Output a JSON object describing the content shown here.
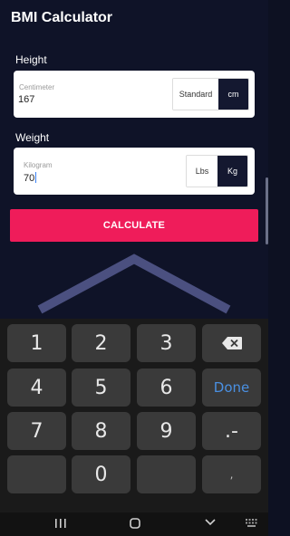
{
  "app": {
    "title": "BMI Calculator"
  },
  "height": {
    "label": "Height",
    "field_label": "Centimeter",
    "value": "167",
    "units": [
      "Standard",
      "cm"
    ],
    "selected_unit": "cm"
  },
  "weight": {
    "label": "Weight",
    "field_label": "Kilogram",
    "value": "70",
    "units": [
      "Lbs",
      "Kg"
    ],
    "selected_unit": "Kg"
  },
  "calculate_label": "CALCULATE",
  "keyboard": {
    "keys": [
      [
        "1",
        "2",
        "3",
        "backspace"
      ],
      [
        "4",
        "5",
        "6",
        "Done"
      ],
      [
        "7",
        "8",
        "9",
        ".-"
      ],
      [
        "",
        "0",
        "",
        ","
      ]
    ],
    "done_label": "Done",
    "backspace_icon": "backspace-icon"
  },
  "colors": {
    "background": "#0f1328",
    "accent": "#ef1c5a",
    "unit_active": "#141830",
    "done_text": "#4a90e2",
    "chevron": "#4b5080"
  },
  "navbar": {
    "icons": [
      "recent-apps-icon",
      "home-icon",
      "back-icon",
      "keyboard-icon"
    ]
  }
}
